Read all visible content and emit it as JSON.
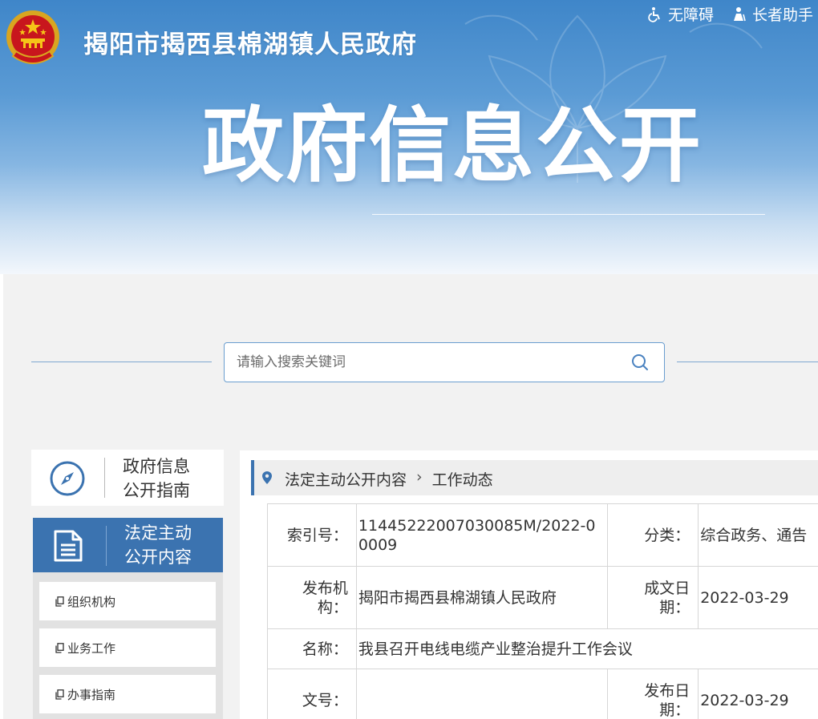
{
  "header": {
    "site_title": "揭阳市揭西县棉湖镇人民政府",
    "big_title": "政府信息公开",
    "accessibility_label": "无障碍",
    "elder_label": "长者助手"
  },
  "search": {
    "placeholder": "请输入搜索关键词"
  },
  "sidebar": {
    "guide_label": "政府信息公开指南",
    "legal_label": "法定主动公开内容",
    "items": [
      {
        "label": "组织机构"
      },
      {
        "label": "业务工作"
      },
      {
        "label": "办事指南"
      }
    ]
  },
  "breadcrumb": {
    "level1": "法定主动公开内容",
    "separator": "›",
    "level2": "工作动态"
  },
  "meta": {
    "index_label": "索引号：",
    "index_value": "11445222007030085M/2022-00009",
    "category_label": "分类：",
    "category_value": "综合政务、通告",
    "publisher_label": "发布机构：",
    "publisher_value": "揭阳市揭西县棉湖镇人民政府",
    "written_date_label": "成文日期：",
    "written_date_value": "2022-03-29",
    "name_label": "名称：",
    "name_value": "我县召开电线电缆产业整治提升工作会议",
    "doc_no_label": "文号：",
    "doc_no_value": "",
    "publish_date_label": "发布日期：",
    "publish_date_value": "2022-03-29"
  },
  "colors": {
    "primary": "#3b73b0",
    "banner_top": "#3f86c9"
  }
}
